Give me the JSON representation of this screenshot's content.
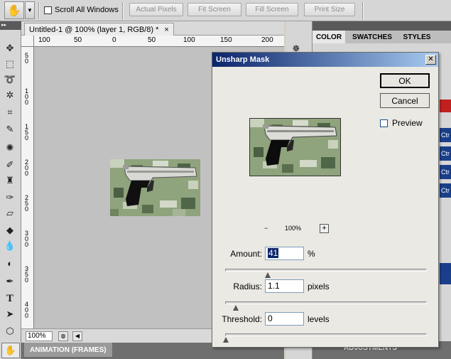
{
  "options_bar": {
    "scroll_all_windows_label": "Scroll All Windows",
    "actual_pixels_label": "Actual Pixels",
    "fit_screen_label": "Fit Screen",
    "fill_screen_label": "Fill Screen",
    "print_size_label": "Print Size"
  },
  "document": {
    "tab_title": "Untitled-1 @ 100% (layer 1, RGB/8) *",
    "close_glyph": "×",
    "zoom_value": "100%",
    "ruler_h": [
      "100",
      "50",
      "0",
      "50",
      "100",
      "150",
      "200"
    ],
    "ruler_v": [
      "50",
      "100",
      "150",
      "200",
      "250",
      "300",
      "350",
      "400"
    ]
  },
  "animation_panel": {
    "tab_label": "ANIMATION (FRAMES)"
  },
  "panels": {
    "tabs": [
      "COLOR",
      "SWATCHES",
      "STYLES"
    ],
    "ctr_labels": [
      "Ctr",
      "Ctr",
      "Ctr",
      "Ctr"
    ],
    "adjustments_label": "ADJUSTMENTS"
  },
  "dialog": {
    "title": "Unsharp Mask",
    "close_glyph": "✕",
    "ok_label": "OK",
    "cancel_label": "Cancel",
    "preview_label": "Preview",
    "zoom_minus": "−",
    "zoom_plus": "+",
    "zoom_value": "100%",
    "amount_label": "Amount:",
    "amount_value": "41",
    "amount_unit": "%",
    "amount_slider_level": 0.21,
    "radius_label": "Radius:",
    "radius_value": "1.1",
    "radius_unit": "pixels",
    "radius_slider_level": 0.05,
    "threshold_label": "Threshold:",
    "threshold_value": "0",
    "threshold_unit": "levels",
    "threshold_slider_level": 0.0
  },
  "icons": {
    "hand_tool": "hand-icon",
    "move_tool": "move-icon",
    "marquee_tool": "marquee-icon",
    "lasso_tool": "lasso-icon",
    "magic_wand_tool": "magic-wand-icon",
    "crop_tool": "crop-icon",
    "eyedropper_tool": "eyedropper-icon",
    "heal_tool": "heal-icon",
    "brush_tool": "brush-icon",
    "stamp_tool": "stamp-icon",
    "history_brush_tool": "history-brush-icon",
    "eraser_tool": "eraser-icon",
    "bucket_tool": "bucket-icon",
    "blur_tool": "blur-icon",
    "dodge_tool": "dodge-icon",
    "pen_tool": "pen-icon",
    "type_tool": "type-icon",
    "path_select_tool": "path-select-icon",
    "shape_tool": "shape-icon"
  }
}
